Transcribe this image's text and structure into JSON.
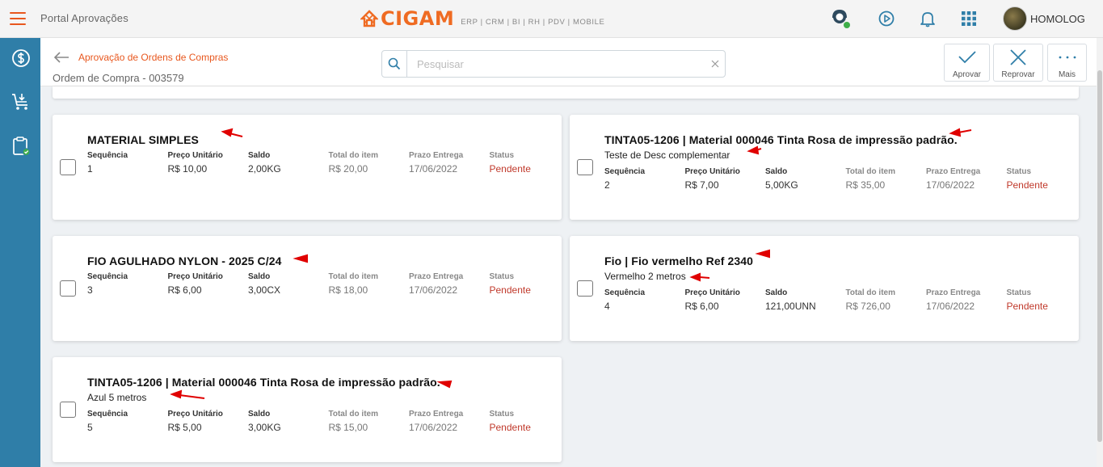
{
  "topbar": {
    "portal_title": "Portal Aprovações",
    "logo_text": "CIGAM",
    "logo_tagline": "ERP | CRM | BI | RH | PDV | MOBILE",
    "user_name": "HOMOLOG",
    "brand_color": "#ef6b22"
  },
  "sidebar": {
    "color": "#2f7ea8",
    "items": [
      {
        "icon": "dollar-icon"
      },
      {
        "icon": "cart-icon"
      },
      {
        "icon": "clipboard-check-icon"
      }
    ]
  },
  "header": {
    "breadcrumb": "Aprovação de Ordens de Compras",
    "page_title": "Ordem de Compra - 003579",
    "search_placeholder": "Pesquisar",
    "actions": {
      "approve": "Aprovar",
      "reject": "Reprovar",
      "more": "Mais"
    }
  },
  "labels": {
    "seq": "Sequência",
    "unit_price": "Preço Unitário",
    "balance": "Saldo",
    "item_total": "Total do item",
    "delivery": "Prazo Entrega",
    "status": "Status"
  },
  "items": [
    {
      "title": "MATERIAL SIMPLES",
      "desc": "",
      "seq": "1",
      "unit_price": "R$ 10,00",
      "balance": "2,00KG",
      "total": "R$ 20,00",
      "delivery": "17/06/2022",
      "status": "Pendente"
    },
    {
      "title": "TINTA05-1206 | Material 000046 Tinta Rosa de impressão padrão.",
      "desc": "Teste de Desc complementar",
      "seq": "2",
      "unit_price": "R$ 7,00",
      "balance": "5,00KG",
      "total": "R$ 35,00",
      "delivery": "17/06/2022",
      "status": "Pendente"
    },
    {
      "title": "FIO AGULHADO NYLON - 2025 C/24",
      "desc": "",
      "seq": "3",
      "unit_price": "R$ 6,00",
      "balance": "3,00CX",
      "total": "R$ 18,00",
      "delivery": "17/06/2022",
      "status": "Pendente"
    },
    {
      "title": "Fio | Fio vermelho Ref 2340",
      "desc": "Vermelho 2 metros",
      "seq": "4",
      "unit_price": "R$ 6,00",
      "balance": "121,00UNN",
      "total": "R$ 726,00",
      "delivery": "17/06/2022",
      "status": "Pendente"
    },
    {
      "title": "TINTA05-1206 | Material 000046 Tinta Rosa de impressão padrão.",
      "desc": "Azul 5 metros",
      "seq": "5",
      "unit_price": "R$ 5,00",
      "balance": "3,00KG",
      "total": "R$ 15,00",
      "delivery": "17/06/2022",
      "status": "Pendente"
    }
  ]
}
